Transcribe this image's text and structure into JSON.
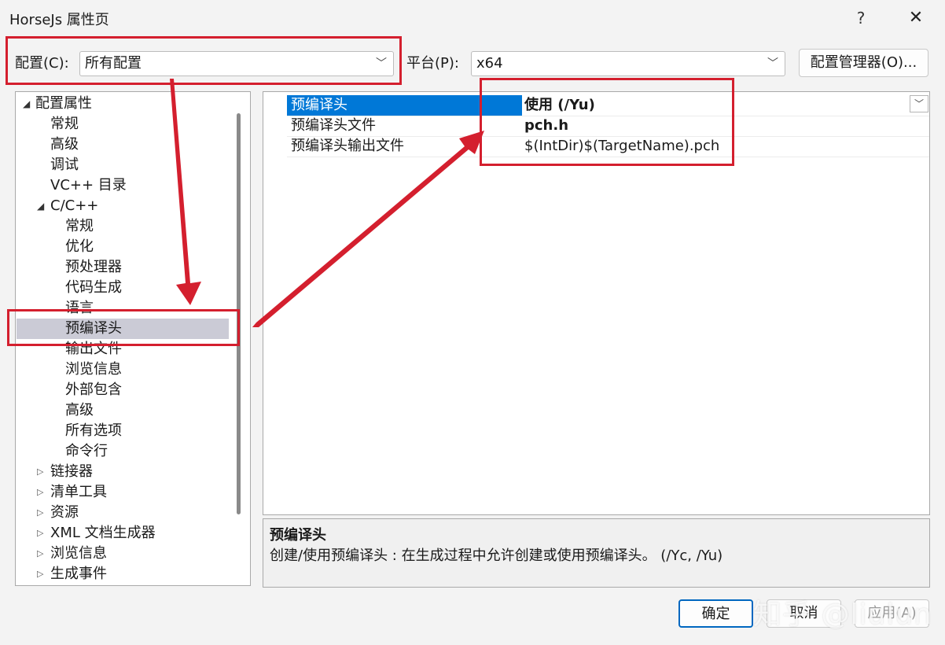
{
  "window": {
    "title": "HorseJs 属性页",
    "help": "?",
    "close": "✕"
  },
  "config": {
    "label": "配置(C):",
    "value": "所有配置"
  },
  "platform": {
    "label": "平台(P):",
    "value": "x64"
  },
  "config_manager_label": "配置管理器(O)...",
  "tree": {
    "root": "配置属性",
    "items": {
      "general": "常规",
      "advanced": "高级",
      "debugging": "调试",
      "vc_dirs": "VC++ 目录",
      "cpp": "C/C++",
      "cpp_general": "常规",
      "optimization": "优化",
      "preprocessor": "预处理器",
      "code_gen": "代码生成",
      "language": "语言",
      "precompiled": "预编译头",
      "output_files": "输出文件",
      "browse_info": "浏览信息",
      "external_includes": "外部包含",
      "cpp_advanced": "高级",
      "all_options": "所有选项",
      "command_line": "命令行",
      "linker": "链接器",
      "manifest_tool": "清单工具",
      "resources": "资源",
      "xml_doc": "XML 文档生成器",
      "browse_info2": "浏览信息",
      "build_events": "生成事件"
    }
  },
  "grid": {
    "rows": [
      {
        "name": "预编译头",
        "value": "使用 (/Yu)"
      },
      {
        "name": "预编译头文件",
        "value": "pch.h"
      },
      {
        "name": "预编译头输出文件",
        "value": "$(IntDir)$(TargetName).pch"
      }
    ]
  },
  "description": {
    "title": "预编译头",
    "text": "创建/使用预编译头 : 在生成过程中允许创建或使用预编译头。     (/Yc, /Yu)"
  },
  "buttons": {
    "ok": "确定",
    "cancel": "取消",
    "apply": "应用(A)"
  },
  "watermark": "知乎 @liulun",
  "annotation_color": "#d41f2e"
}
